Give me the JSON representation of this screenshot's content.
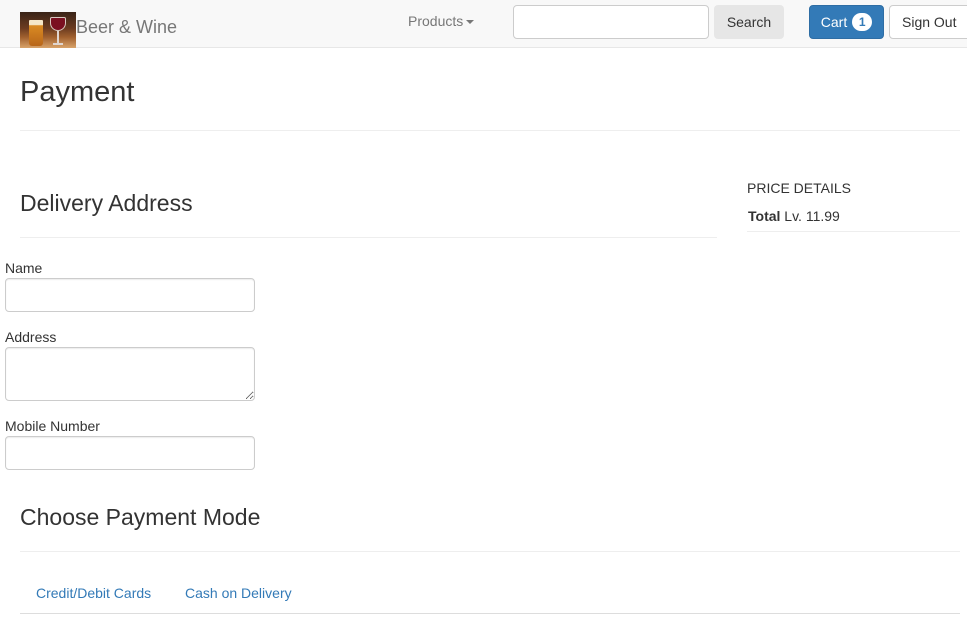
{
  "navbar": {
    "brand_name": "Beer & Wine",
    "products_label": "Products",
    "search": {
      "value": "",
      "placeholder": "",
      "button_label": "Search"
    },
    "cart": {
      "label": "Cart",
      "count": "1"
    },
    "signout_label": "Sign Out"
  },
  "page": {
    "title": "Payment"
  },
  "delivery": {
    "title": "Delivery Address",
    "fields": {
      "name": {
        "label": "Name",
        "value": ""
      },
      "address": {
        "label": "Address",
        "value": ""
      },
      "mobile": {
        "label": "Mobile Number",
        "value": ""
      }
    }
  },
  "price_details": {
    "heading": "PRICE DETAILS",
    "total_label": "Total",
    "total_value": "Lv. 11.99"
  },
  "payment": {
    "title": "Choose Payment Mode",
    "tabs": [
      {
        "label": "Credit/Debit Cards"
      },
      {
        "label": "Cash on Delivery"
      }
    ]
  },
  "colors": {
    "primary": "#337ab7",
    "navbar_bg": "#f8f8f8",
    "muted_text": "#777777"
  }
}
